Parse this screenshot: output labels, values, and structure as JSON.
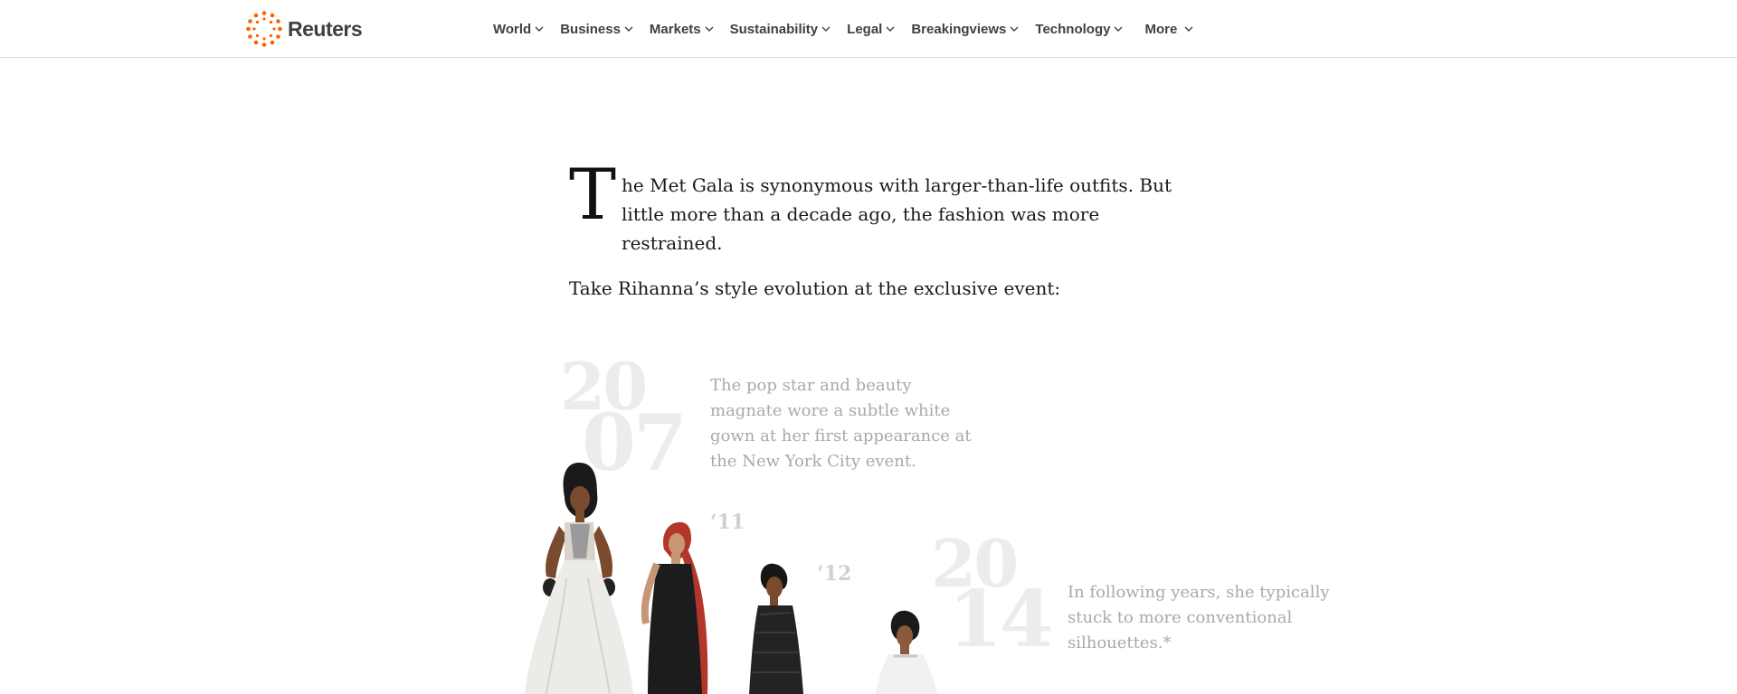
{
  "brand": {
    "name": "Reuters",
    "accent": "#fa6400"
  },
  "nav": {
    "items": [
      {
        "label": "World"
      },
      {
        "label": "Business"
      },
      {
        "label": "Markets"
      },
      {
        "label": "Sustainability"
      },
      {
        "label": "Legal"
      },
      {
        "label": "Breakingviews"
      },
      {
        "label": "Technology"
      },
      {
        "label": "More"
      }
    ],
    "chevron_icon": "chevron-down-icon"
  },
  "intro": {
    "dropcap": "T",
    "lead": "he Met Gala is synonymous with larger-than-life outfits. But little more than a decade ago, the fashion was more restrained.",
    "second": "Take Rihanna’s style evolution at the exclusive event:"
  },
  "timeline": {
    "y2007": {
      "top": "20",
      "bottom": "07",
      "caption": "The pop star and beauty magnate wore a subtle white gown at her first appearance at the New York City event."
    },
    "y2011": "‘11",
    "y2012": "‘12",
    "y2014": {
      "top": "20",
      "bottom": "14",
      "caption": "In following years, she typically stuck to more conventional silhouettes.*"
    }
  }
}
